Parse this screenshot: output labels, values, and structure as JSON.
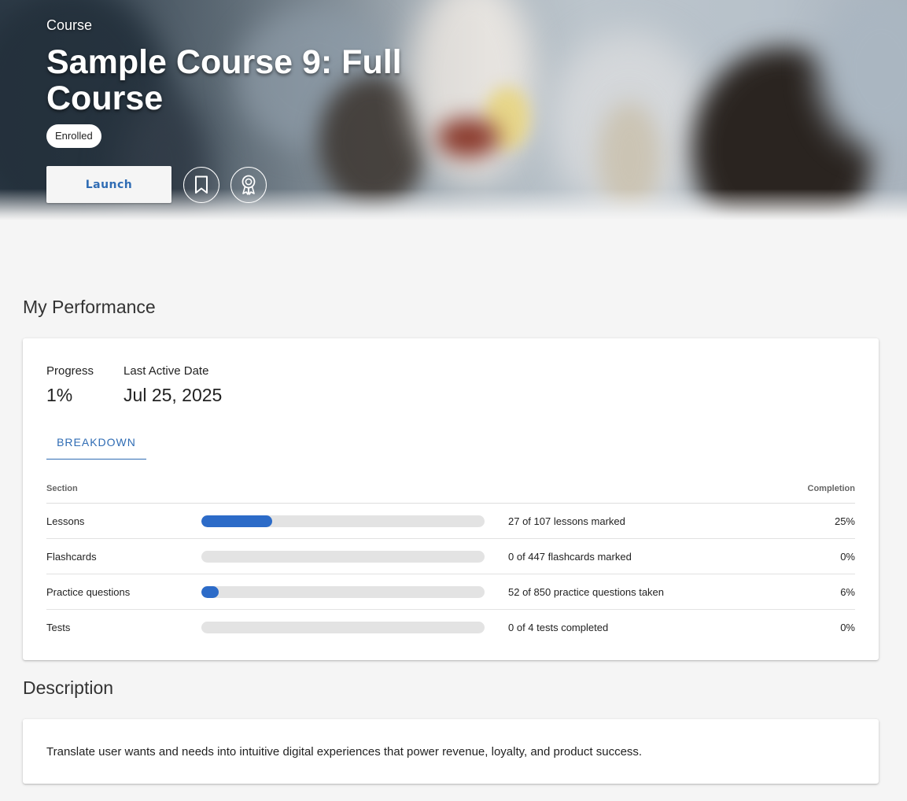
{
  "hero": {
    "kicker": "Course",
    "title": "Sample Course 9: Full Course",
    "badge": "Enrolled",
    "launch_label": "Launch"
  },
  "performance": {
    "heading": "My Performance",
    "progress_label": "Progress",
    "progress_value": "1%",
    "last_active_label": "Last Active Date",
    "last_active_value": "Jul 25, 2025",
    "tab_label": "BREAKDOWN",
    "columns": {
      "section": "Section",
      "completion": "Completion"
    },
    "rows": [
      {
        "name": "Lessons",
        "fraction": 0.25,
        "detail": "27 of 107 lessons marked",
        "pct": "25%"
      },
      {
        "name": "Flashcards",
        "fraction": 0,
        "detail": "0 of 447 flashcards marked",
        "pct": "0%"
      },
      {
        "name": "Practice questions",
        "fraction": 0.06,
        "detail": "52 of 850 practice questions taken",
        "pct": "6%"
      },
      {
        "name": "Tests",
        "fraction": 0,
        "detail": "0 of 4 tests completed",
        "pct": "0%"
      }
    ]
  },
  "description": {
    "heading": "Description",
    "text": "Translate user wants and needs into intuitive digital experiences that power revenue, loyalty, and product success."
  },
  "icons": {
    "bookmark": "bookmark-icon",
    "certificate": "certificate-icon"
  },
  "colors": {
    "accent": "#2f6cb4",
    "progress_fill": "#2c6bc8",
    "progress_track": "#e3e3e3",
    "page_bg": "#f5f5f5"
  }
}
